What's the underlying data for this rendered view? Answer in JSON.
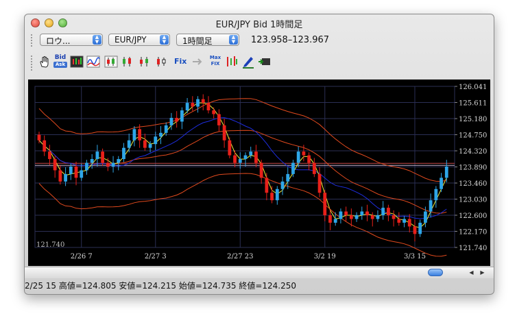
{
  "window": {
    "title": "EUR/JPY Bid 1時間足"
  },
  "toolbar": {
    "chart_type_select": "ロウ...",
    "pair_select": "EUR/JPY",
    "timeframe_select": "1時間足",
    "price_range": "123.958–123.967",
    "icons": [
      "hand-icon",
      "bid-ask-icon",
      "indicator-icon",
      "wave-icon",
      "candle-icon",
      "candle-icon",
      "candle-icon",
      "candle-icon",
      "fix-icon",
      "arrow-icon",
      "max-fix-icon",
      "bars-icon",
      "pen-icon",
      "export-icon"
    ],
    "bid_label": "Bid",
    "ask_label": "Ask",
    "fix_label": "Fix",
    "max_label": "Max",
    "maxfix_label": "FIX"
  },
  "colors": {
    "background": "#000000",
    "grid": "#2b2f55",
    "up_candle": "#2ea6e8",
    "down_candle": "#e8201a",
    "ma_fast": "#f0ef3a",
    "ma_mid": "#1f2ee0",
    "ma_slow": "#e24a1e",
    "current_price_line": "#c84a4a"
  },
  "chart_data": {
    "type": "candlestick",
    "y_ticks": [
      "126.041",
      "125.611",
      "125.180",
      "124.750",
      "124.320",
      "123.890",
      "123.460",
      "123.030",
      "122.600",
      "122.170",
      "121.740"
    ],
    "ylim": [
      121.74,
      126.041
    ],
    "x_ticks": [
      "2/26 7",
      "2/27 3",
      "2/27 23",
      "3/2 19",
      "3/3 15"
    ],
    "current_price": 123.96,
    "corner_label": "121.740",
    "close": [
      124.6,
      124.3,
      124.1,
      123.8,
      123.5,
      123.7,
      123.9,
      123.6,
      123.8,
      124.0,
      124.1,
      124.3,
      124.0,
      123.9,
      124.0,
      124.1,
      124.4,
      124.6,
      124.9,
      124.6,
      124.4,
      124.5,
      124.7,
      124.8,
      125.0,
      125.2,
      125.1,
      125.4,
      125.6,
      125.5,
      125.7,
      125.6,
      125.4,
      125.3,
      125.0,
      124.6,
      124.2,
      124.0,
      124.1,
      124.2,
      124.3,
      124.0,
      123.6,
      123.2,
      123.0,
      123.3,
      123.5,
      123.7,
      124.0,
      124.3,
      124.2,
      124.0,
      123.7,
      123.2,
      122.6,
      122.4,
      122.5,
      122.7,
      122.6,
      122.5,
      122.6,
      122.7,
      122.6,
      122.5,
      122.6,
      122.8,
      122.6,
      122.5,
      122.4,
      122.5,
      122.3,
      122.1,
      122.4,
      122.7,
      123.0,
      123.3,
      123.6,
      123.9
    ]
  },
  "status_bar": {
    "text": "2/25 15  高値=124.805 安値=124.215 始値=124.735 終値=124.250"
  }
}
